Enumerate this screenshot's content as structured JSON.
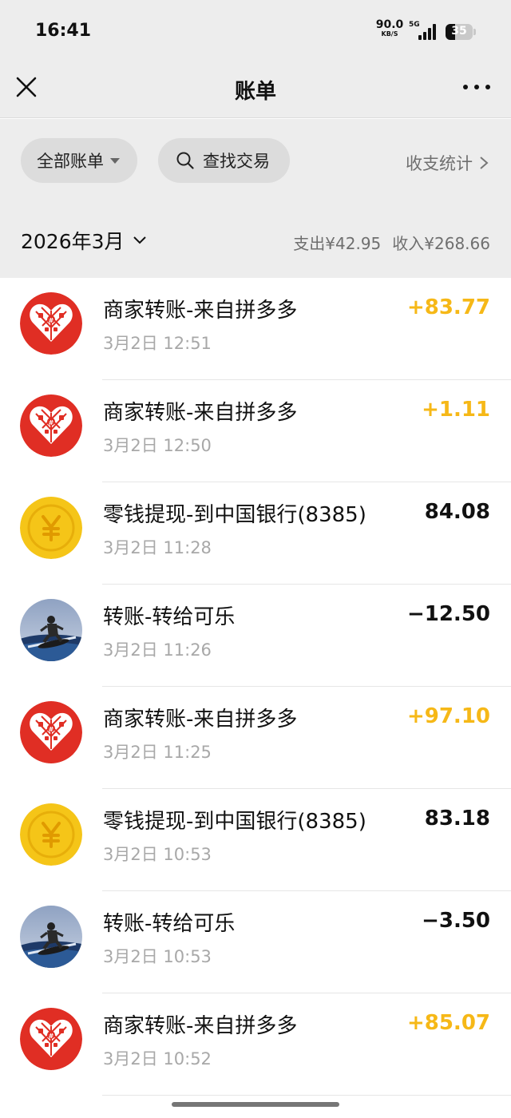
{
  "status_bar": {
    "time": "16:41",
    "net_speed_value": "90.0",
    "net_speed_unit": "KB/S",
    "network_type": "5G",
    "battery": "35",
    "battery_level": 0.35
  },
  "nav": {
    "title": "账单",
    "close_icon": "close-icon",
    "more_icon": "more-icon"
  },
  "filters": {
    "all_bills_label": "全部账单",
    "search_label": "查找交易",
    "stats_label": "收支统计"
  },
  "month": {
    "label": "2026年3月",
    "expense": "支出¥42.95",
    "income": "收入¥268.66"
  },
  "colors": {
    "income_amount": "#f6b817",
    "pinduoduo_red": "#e02e24",
    "change_coin_yellow": "#f5c518",
    "background_gray": "#ededed"
  },
  "transactions": [
    {
      "title": "商家转账-来自拼多多",
      "time": "3月2日 12:51",
      "amount": "+83.77",
      "type": "income",
      "icon": "pinduoduo-icon"
    },
    {
      "title": "商家转账-来自拼多多",
      "time": "3月2日 12:50",
      "amount": "+1.11",
      "type": "income",
      "icon": "pinduoduo-icon"
    },
    {
      "title": "零钱提现-到中国银行(8385)",
      "time": "3月2日 11:28",
      "amount": "84.08",
      "type": "neutral",
      "icon": "yuan-coin-icon"
    },
    {
      "title": "转账-转给可乐",
      "time": "3月2日 11:26",
      "amount": "−12.50",
      "type": "expense",
      "icon": "user-avatar"
    },
    {
      "title": "商家转账-来自拼多多",
      "time": "3月2日 11:25",
      "amount": "+97.10",
      "type": "income",
      "icon": "pinduoduo-icon"
    },
    {
      "title": "零钱提现-到中国银行(8385)",
      "time": "3月2日 10:53",
      "amount": "83.18",
      "type": "neutral",
      "icon": "yuan-coin-icon"
    },
    {
      "title": "转账-转给可乐",
      "time": "3月2日 10:53",
      "amount": "−3.50",
      "type": "expense",
      "icon": "user-avatar"
    },
    {
      "title": "商家转账-来自拼多多",
      "time": "3月2日 10:52",
      "amount": "+85.07",
      "type": "income",
      "icon": "pinduoduo-icon"
    }
  ]
}
